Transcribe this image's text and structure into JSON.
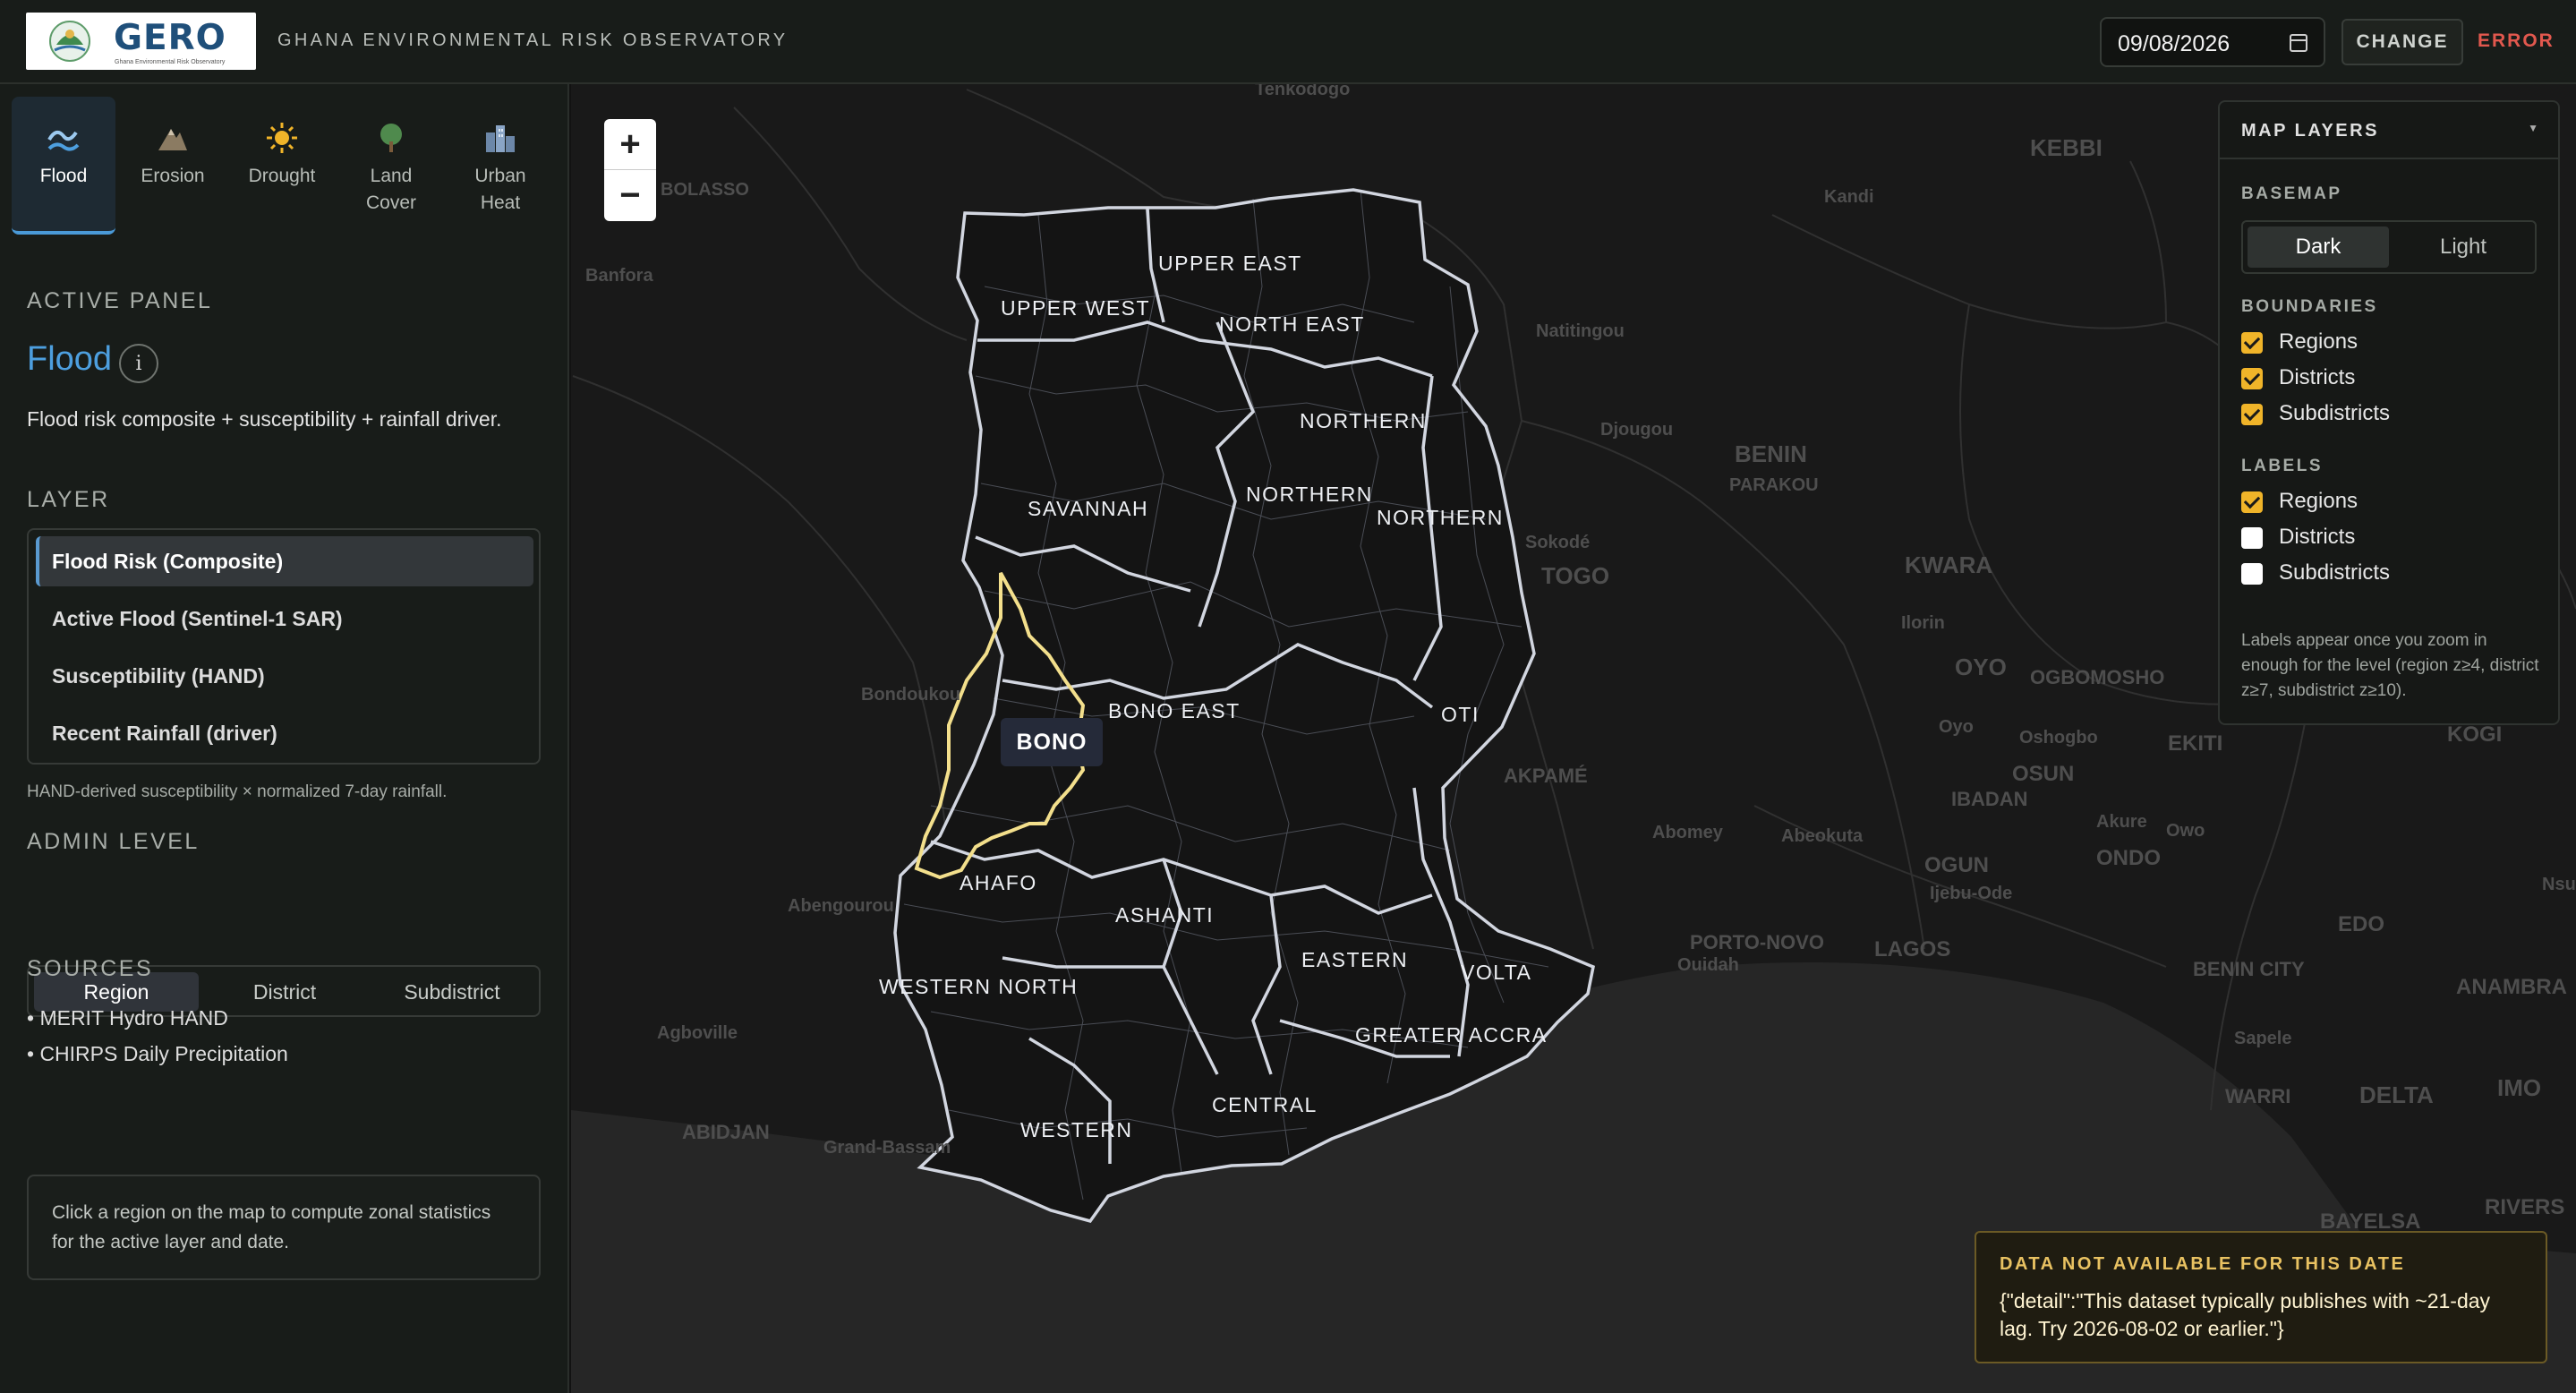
{
  "header": {
    "logo_text": "GERO",
    "logo_subtext": "Ghana Environmental Risk Observatory",
    "app_title": "GHANA ENVIRONMENTAL RISK OBSERVATORY",
    "date_value": "09/08/2026",
    "change_label": "CHANGE",
    "error_label": "ERROR"
  },
  "tabs": [
    {
      "label": "Flood",
      "icon": "wave-icon",
      "active": true
    },
    {
      "label": "Erosion",
      "icon": "mountain-icon",
      "active": false
    },
    {
      "label": "Drought",
      "icon": "sun-icon",
      "active": false
    },
    {
      "label": "Land\nCover",
      "icon": "tree-icon",
      "active": false
    },
    {
      "label": "Urban\nHeat",
      "icon": "city-icon",
      "active": false
    }
  ],
  "panel": {
    "section_label": "ACTIVE PANEL",
    "title": "Flood",
    "info": "i",
    "description": "Flood risk composite + susceptibility + rainfall driver.",
    "layer_section": "LAYER",
    "layers": [
      {
        "label": "Flood Risk (Composite)",
        "active": true
      },
      {
        "label": "Active Flood (Sentinel-1 SAR)",
        "active": false
      },
      {
        "label": "Susceptibility (HAND)",
        "active": false
      },
      {
        "label": "Recent Rainfall (driver)",
        "active": false
      }
    ],
    "layer_note": "HAND-derived susceptibility × normalized 7-day rainfall.",
    "admin_section": "ADMIN LEVEL",
    "admin_levels": [
      {
        "label": "Region",
        "active": true
      },
      {
        "label": "District",
        "active": false
      },
      {
        "label": "Subdistrict",
        "active": false
      }
    ],
    "sources_section": "SOURCES",
    "sources": [
      "• MERIT Hydro HAND",
      "• CHIRPS Daily Precipitation"
    ],
    "hint": "Click a region on the map to compute zonal statistics for the active layer and date."
  },
  "map": {
    "zoom_in": "+",
    "zoom_out": "−",
    "tooltip": "BONO",
    "region_labels": [
      "UPPER EAST",
      "UPPER WEST",
      "NORTH EAST",
      "NORTHERN",
      "SAVANNAH",
      "NORTHERN",
      "NORTHERN",
      "BONO EAST",
      "OTI",
      "AHAFO",
      "ASHANTI",
      "EASTERN",
      "VOLTA",
      "WESTERN NORTH",
      "GREATER ACCRA",
      "CENTRAL",
      "WESTERN"
    ],
    "basemap_labels": [
      "Tenkodogo",
      "KEBBI",
      "Kandi",
      "Banfora",
      "Natitingou",
      "Djougou",
      "BENIN",
      "PARAKOU",
      "Sokodé",
      "TOGO",
      "KWARA",
      "Ilorin",
      "OYO",
      "OGBOMOSHO",
      "Bondoukou",
      "Oyo",
      "Oshogbo",
      "EKITI",
      "KOGI",
      "OSUN",
      "AKPAMÉ",
      "IBADAN",
      "Abomey",
      "Abeokuta",
      "Akure",
      "Owo",
      "ONDO",
      "OGUN",
      "Ijebu-Ode",
      "Abengourou",
      "PORTO-NOVO",
      "Ouidah",
      "LAGOS",
      "EDO",
      "BENIN CITY",
      "ANAMBRA",
      "Agboville",
      "Sapele",
      "WARRI",
      "DELTA",
      "IMO",
      "ABIDJAN",
      "Grand-Bassam",
      "BAYELSA",
      "RIVERS",
      "Nsukk",
      "BOLASSO"
    ]
  },
  "layers_panel": {
    "title": "MAP LAYERS",
    "basemap_section": "BASEMAP",
    "basemap_options": [
      {
        "label": "Dark",
        "active": true
      },
      {
        "label": "Light",
        "active": false
      }
    ],
    "boundaries_section": "BOUNDARIES",
    "boundaries": [
      {
        "label": "Regions",
        "checked": true
      },
      {
        "label": "Districts",
        "checked": true
      },
      {
        "label": "Subdistricts",
        "checked": true
      }
    ],
    "labels_section": "LABELS",
    "labels": [
      {
        "label": "Regions",
        "checked": true
      },
      {
        "label": "Districts",
        "checked": false
      },
      {
        "label": "Subdistricts",
        "checked": false
      }
    ],
    "note": "Labels appear once you zoom in enough for the level (region z≥4, district z≥7, subdistrict z≥10)."
  },
  "error_toast": {
    "title": "DATA NOT AVAILABLE FOR THIS DATE",
    "message": "{\"detail\":\"This dataset typically publishes with ~21-day lag. Try 2026-08-02 or earlier.\"}"
  },
  "colors": {
    "accent": "#4d9fdf",
    "error": "#e2584e",
    "checkbox": "#f0b429",
    "highlight": "#f3df8c"
  }
}
